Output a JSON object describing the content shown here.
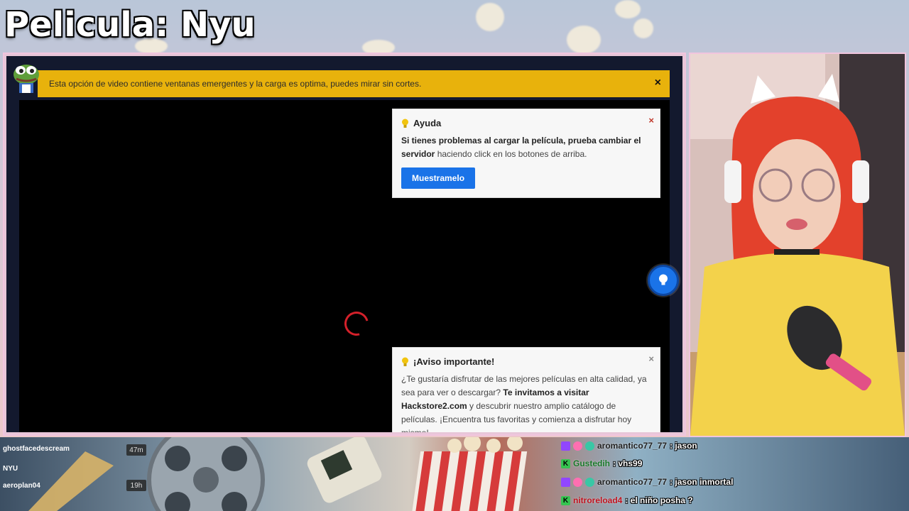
{
  "stream": {
    "title": "Pelicula: Nyu"
  },
  "notice_bar": {
    "text": "Esta opción de video contiene ventanas emergentes y la carga es optima, puedes mirar sin cortes.",
    "close_label": "×"
  },
  "help_card": {
    "title": "Ayuda",
    "body_bold": "Si tienes problemas al cargar la película, prueba cambiar el servidor",
    "body_rest": " haciendo click en los botones de arriba.",
    "button_label": "Muestramelo",
    "close_label": "×"
  },
  "notice_card": {
    "title": "¡Aviso importante!",
    "body_1": "¿Te gustaría disfrutar de las mejores películas en alta calidad, ya sea para ver o descargar? ",
    "body_bold": "Te invitamos a visitar Hackstore2.com",
    "body_2": " y descubrir nuestro amplio catálogo de películas. ¡Encuentra tus favoritas y comienza a disfrutar hoy mismo!",
    "close_label": "×"
  },
  "chat_left": [
    {
      "user": "ghostfacedescream",
      "time": "47m"
    },
    {
      "user": "NYU",
      "time": ""
    },
    {
      "user": "aeroplan04",
      "time": "19h"
    }
  ],
  "chat_right": [
    {
      "user": "aromantico77_77",
      "message": ": jason",
      "badges": [
        "p",
        "pink",
        "teal"
      ],
      "color": "dark"
    },
    {
      "user": "Gustedih",
      "message": ": vhs99",
      "badges": [
        "k"
      ],
      "color": "green"
    },
    {
      "user": "aromantico77_77",
      "message": ": jason inmortal",
      "badges": [
        "p",
        "pink",
        "teal"
      ],
      "color": "dark"
    },
    {
      "user": "nitroreload4",
      "message": ": el niño posha ?",
      "badges": [
        "k"
      ],
      "color": "red"
    }
  ],
  "colors": {
    "notice_yellow": "#e8b20c",
    "button_blue": "#1a73e8",
    "spinner_red": "#d3202a"
  }
}
